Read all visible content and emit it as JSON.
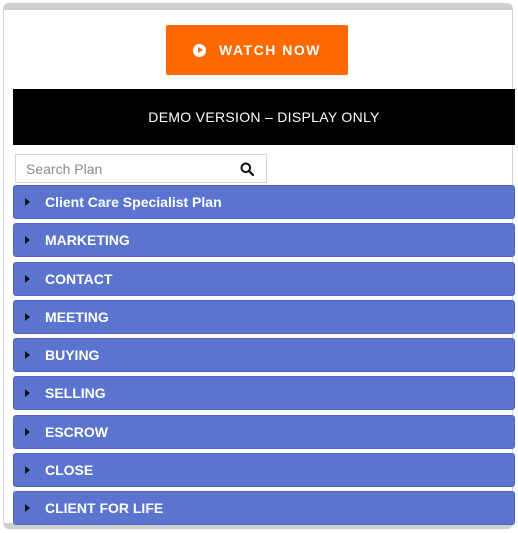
{
  "watch_button": {
    "label": "WATCH NOW",
    "icon": "play-circle-icon",
    "color": "#ff6a00"
  },
  "banner": {
    "text": "DEMO VERSION – DISPLAY ONLY"
  },
  "search": {
    "placeholder": "Search Plan",
    "value": "",
    "icon": "search-icon"
  },
  "plan_items": [
    {
      "label": "Client Care Specialist Plan"
    },
    {
      "label": "MARKETING"
    },
    {
      "label": "CONTACT"
    },
    {
      "label": "MEETING"
    },
    {
      "label": "BUYING"
    },
    {
      "label": "SELLING"
    },
    {
      "label": "ESCROW"
    },
    {
      "label": "CLOSE"
    },
    {
      "label": "CLIENT FOR LIFE"
    }
  ],
  "colors": {
    "accordion": "#5a74d0",
    "banner": "#000000"
  }
}
